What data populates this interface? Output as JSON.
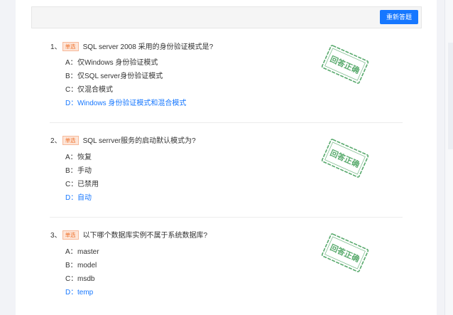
{
  "toolbar": {
    "redo_label": "重新答题"
  },
  "colors": {
    "accent": "#1677ff",
    "tag": "#f0722c",
    "stamp": "#3a9a52"
  },
  "questions": [
    {
      "number": "1、",
      "type": "单选",
      "text": "SQL server 2008 采用的身份验证模式是?",
      "options": [
        {
          "letter": "A：",
          "text": "仅Windows 身份验证模式"
        },
        {
          "letter": "B：",
          "text": "仅SQL server身份验证模式"
        },
        {
          "letter": "C：",
          "text": "仅混合模式"
        },
        {
          "letter": "D：",
          "text": "Windows 身份验证模式和混合模式"
        }
      ],
      "correct_option": "D",
      "stamp": "回答正确"
    },
    {
      "number": "2、",
      "type": "单选",
      "text": "SQL serrver服务的启动默认模式为?",
      "options": [
        {
          "letter": "A：",
          "text": "恢复"
        },
        {
          "letter": "B：",
          "text": "手动"
        },
        {
          "letter": "C：",
          "text": "已禁用"
        },
        {
          "letter": "D：",
          "text": "自动"
        }
      ],
      "correct_option": "D",
      "stamp": "回答正确"
    },
    {
      "number": "3、",
      "type": "单选",
      "text": "以下哪个数据库实例不属于系统数据库?",
      "options": [
        {
          "letter": "A：",
          "text": "master"
        },
        {
          "letter": "B：",
          "text": "model"
        },
        {
          "letter": "C：",
          "text": "msdb"
        },
        {
          "letter": "D：",
          "text": "temp"
        }
      ],
      "correct_option": "D",
      "stamp": "回答正确"
    }
  ]
}
